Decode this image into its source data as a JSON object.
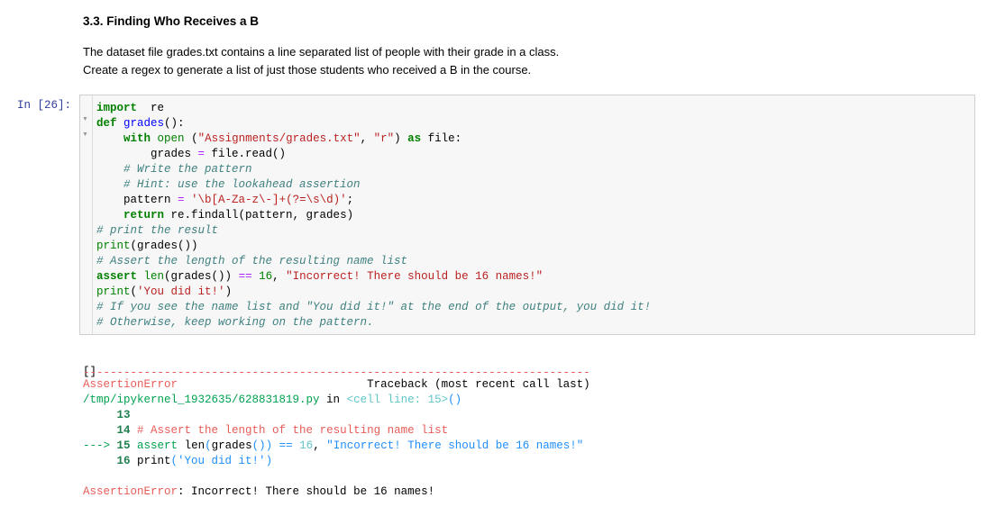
{
  "markdown": {
    "heading": "3.3. Finding Who Receives a B",
    "paragraph_line1": "The dataset file grades.txt contains a line separated list of people with their grade in a class.",
    "paragraph_line2": "Create a regex to generate a list of just those students who received a B in the course."
  },
  "cell": {
    "prompt": "In [26]:",
    "lines": [
      [
        [
          "kw",
          "import"
        ],
        [
          "",
          "  re"
        ]
      ],
      [
        [
          "kw",
          "def"
        ],
        [
          "",
          " "
        ],
        [
          "fn",
          "grades"
        ],
        [
          "",
          "():"
        ]
      ],
      [
        [
          "",
          "    "
        ],
        [
          "kw",
          "with"
        ],
        [
          "",
          " "
        ],
        [
          "bi",
          "open"
        ],
        [
          "",
          " ("
        ],
        [
          "str",
          "\"Assignments/grades.txt\""
        ],
        [
          "",
          ", "
        ],
        [
          "str",
          "\"r\""
        ],
        [
          "",
          ") "
        ],
        [
          "kw",
          "as"
        ],
        [
          "",
          " file:"
        ]
      ],
      [
        [
          "",
          "        grades "
        ],
        [
          "op",
          "="
        ],
        [
          "",
          " file.read()"
        ]
      ],
      [
        [
          "",
          "    "
        ],
        [
          "cm",
          "# Write the pattern"
        ]
      ],
      [
        [
          "",
          "    "
        ],
        [
          "cm",
          "# Hint: use the lookahead assertion"
        ]
      ],
      [
        [
          "",
          "    pattern "
        ],
        [
          "op",
          "="
        ],
        [
          "",
          " "
        ],
        [
          "str",
          "'\\b[A-Za-z\\-]+(?=\\s\\d)'"
        ],
        [
          "",
          ";"
        ]
      ],
      [
        [
          "",
          "    "
        ],
        [
          "kw",
          "return"
        ],
        [
          "",
          " re.findall(pattern, grades)"
        ]
      ],
      [
        [
          "cm",
          "# print the result"
        ]
      ],
      [
        [
          "bi",
          "print"
        ],
        [
          "",
          "(grades())"
        ]
      ],
      [
        [
          "cm",
          "# Assert the length of the resulting name list"
        ]
      ],
      [
        [
          "kw",
          "assert"
        ],
        [
          "",
          " "
        ],
        [
          "bi",
          "len"
        ],
        [
          "",
          "(grades()) "
        ],
        [
          "op",
          "=="
        ],
        [
          "",
          " "
        ],
        [
          "num",
          "16"
        ],
        [
          "",
          ", "
        ],
        [
          "str",
          "\"Incorrect! There should be 16 names!\""
        ]
      ],
      [
        [
          "bi",
          "print"
        ],
        [
          "",
          "("
        ],
        [
          "str",
          "'You did it!'"
        ],
        [
          "",
          ")"
        ]
      ],
      [
        [
          "cm",
          "# If you see the name list and \"You did it!\" at the end of the output, you did it!"
        ]
      ],
      [
        [
          "cm",
          "# Otherwise, keep working on the pattern."
        ]
      ]
    ]
  },
  "output": {
    "stdout": "[]",
    "lines": [
      [
        [
          "err",
          "---------------------------------------------------------------------------"
        ]
      ],
      [
        [
          "err",
          "AssertionError"
        ],
        [
          "",
          "                            Traceback (most recent call last)"
        ]
      ],
      [
        [
          "grn",
          "/tmp/ipykernel_1932635/628831819.py"
        ],
        [
          "",
          " in "
        ],
        [
          "cyan",
          "<cell line: 15>"
        ],
        [
          "blue",
          "()"
        ]
      ],
      [
        [
          "grnb",
          "     13"
        ]
      ],
      [
        [
          "grnb",
          "     14"
        ],
        [
          "",
          " "
        ],
        [
          "red",
          "# Assert the length of the resulting name list"
        ]
      ],
      [
        [
          "grn",
          "---> "
        ],
        [
          "grnb",
          "15"
        ],
        [
          "",
          " "
        ],
        [
          "grn",
          "assert"
        ],
        [
          "",
          " len"
        ],
        [
          "blue",
          "("
        ],
        [
          "",
          "grades"
        ],
        [
          "blue",
          "())"
        ],
        [
          "",
          " "
        ],
        [
          "blue",
          "=="
        ],
        [
          "",
          " "
        ],
        [
          "cyan",
          "16"
        ],
        [
          "",
          ", "
        ],
        [
          "blue",
          "\"Incorrect! There should be 16 names!\""
        ]
      ],
      [
        [
          "grnb",
          "     16"
        ],
        [
          "",
          " print"
        ],
        [
          "blue",
          "("
        ],
        [
          "blue",
          "'You did it!'"
        ],
        [
          "blue",
          ")"
        ]
      ],
      [
        [
          "",
          ""
        ]
      ],
      [
        [
          "err",
          "AssertionError"
        ],
        [
          "",
          ": Incorrect! There should be 16 names!"
        ]
      ]
    ]
  },
  "colors": {
    "prompt": "#303F9F",
    "keyword": "#008000",
    "string": "#BA2121",
    "comment": "#408080",
    "error": "#E75C58"
  }
}
